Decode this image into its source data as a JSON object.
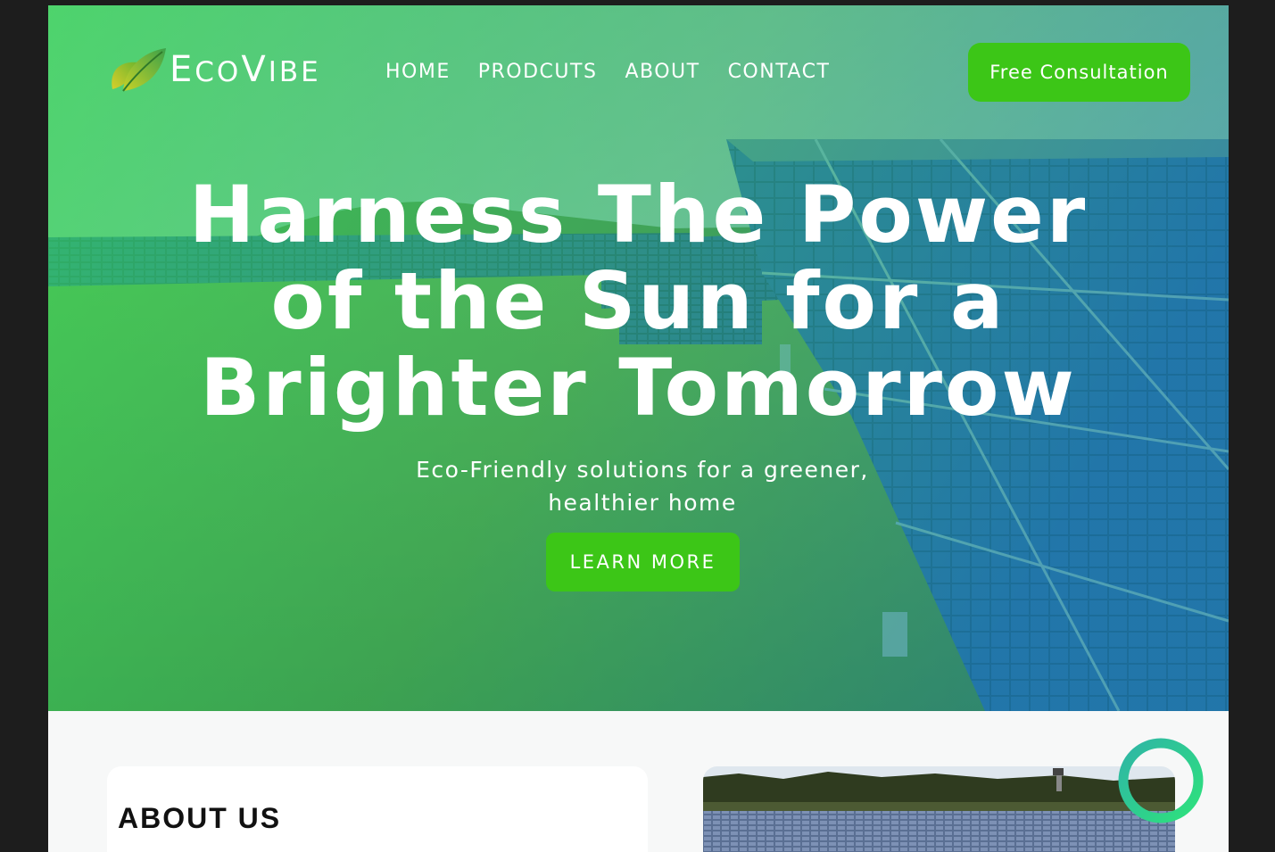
{
  "brand": {
    "name_first": "E",
    "name_mid": "CO",
    "name_second": "V",
    "name_rest": "IBE"
  },
  "nav": {
    "items": [
      {
        "label": "HOME"
      },
      {
        "label": "PRODCUTS"
      },
      {
        "label": "ABOUT"
      },
      {
        "label": "CONTACT"
      }
    ],
    "cta_label": "Free Consultation"
  },
  "hero": {
    "headline_lines": [
      "Harness The Power",
      "of the Sun for a",
      "Brighter Tomorrow"
    ],
    "subtitle_lines": [
      "Eco-Friendly solutions for a greener,",
      "healthier home"
    ],
    "button_label": "LEARN MORE"
  },
  "about": {
    "title": "ABOUT US"
  },
  "colors": {
    "accent_green": "#3cc617",
    "overlay_green": "#3ddc6a",
    "overlay_teal": "#2aa59a",
    "page_bg": "#f7f8f8",
    "outer_bg": "#1d1d1d"
  },
  "icons": [
    "leaf-logo-icon",
    "decorative-ring-icon"
  ]
}
